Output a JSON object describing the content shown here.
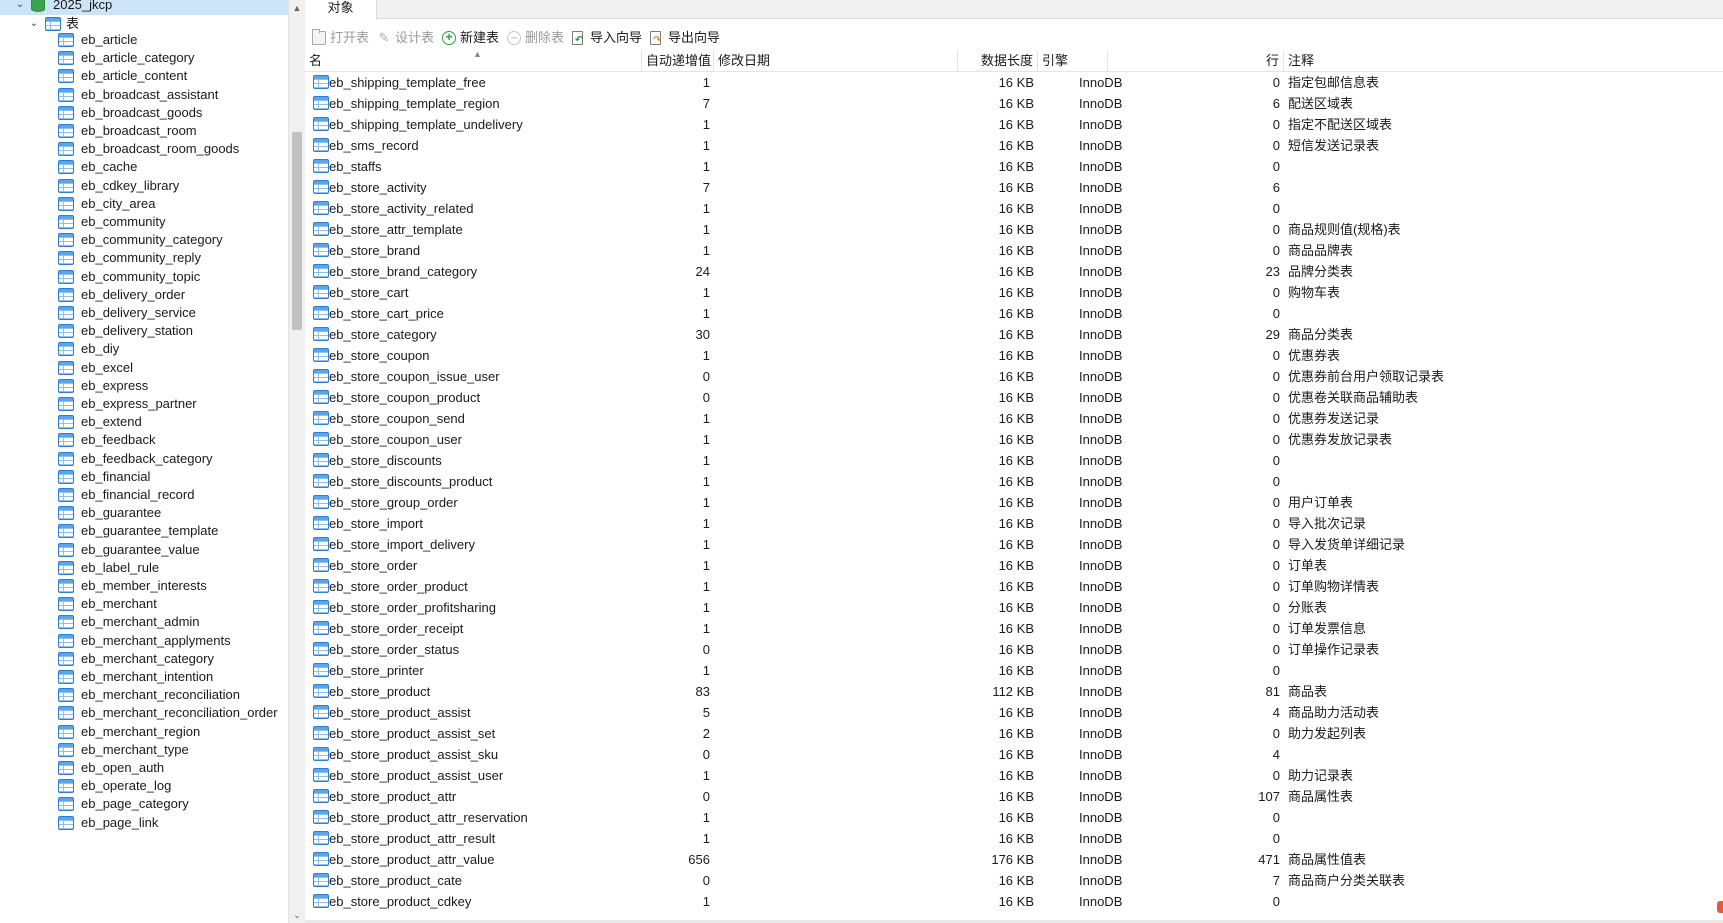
{
  "navigator": {
    "database": "2025_jkcp",
    "tables_node": "表",
    "tables": [
      "eb_article",
      "eb_article_category",
      "eb_article_content",
      "eb_broadcast_assistant",
      "eb_broadcast_goods",
      "eb_broadcast_room",
      "eb_broadcast_room_goods",
      "eb_cache",
      "eb_cdkey_library",
      "eb_city_area",
      "eb_community",
      "eb_community_category",
      "eb_community_reply",
      "eb_community_topic",
      "eb_delivery_order",
      "eb_delivery_service",
      "eb_delivery_station",
      "eb_diy",
      "eb_excel",
      "eb_express",
      "eb_express_partner",
      "eb_extend",
      "eb_feedback",
      "eb_feedback_category",
      "eb_financial",
      "eb_financial_record",
      "eb_guarantee",
      "eb_guarantee_template",
      "eb_guarantee_value",
      "eb_label_rule",
      "eb_member_interests",
      "eb_merchant",
      "eb_merchant_admin",
      "eb_merchant_applyments",
      "eb_merchant_category",
      "eb_merchant_intention",
      "eb_merchant_reconciliation",
      "eb_merchant_reconciliation_order",
      "eb_merchant_region",
      "eb_merchant_type",
      "eb_open_auth",
      "eb_operate_log",
      "eb_page_category",
      "eb_page_link"
    ]
  },
  "tabs": {
    "objects": "对象"
  },
  "toolbar": {
    "open_table": "打开表",
    "design_table": "设计表",
    "new_table": "新建表",
    "delete_table": "删除表",
    "import_wizard": "导入向导",
    "export_wizard": "导出向导"
  },
  "columns": {
    "name": "名",
    "auto_increment": "自动递增值",
    "modified": "修改日期",
    "data_length": "数据长度",
    "engine": "引擎",
    "rows": "行",
    "comment": "注释"
  },
  "table_rows": [
    {
      "name": "eb_shipping_template_free",
      "auto_inc": "1",
      "modified": "",
      "size": "16 KB",
      "engine": "InnoDB",
      "rows": "0",
      "comment": "指定包邮信息表"
    },
    {
      "name": "eb_shipping_template_region",
      "auto_inc": "7",
      "modified": "",
      "size": "16 KB",
      "engine": "InnoDB",
      "rows": "6",
      "comment": "配送区域表"
    },
    {
      "name": "eb_shipping_template_undelivery",
      "auto_inc": "1",
      "modified": "",
      "size": "16 KB",
      "engine": "InnoDB",
      "rows": "0",
      "comment": "指定不配送区域表"
    },
    {
      "name": "eb_sms_record",
      "auto_inc": "1",
      "modified": "",
      "size": "16 KB",
      "engine": "InnoDB",
      "rows": "0",
      "comment": "短信发送记录表"
    },
    {
      "name": "eb_staffs",
      "auto_inc": "1",
      "modified": "",
      "size": "16 KB",
      "engine": "InnoDB",
      "rows": "0",
      "comment": ""
    },
    {
      "name": "eb_store_activity",
      "auto_inc": "7",
      "modified": "",
      "size": "16 KB",
      "engine": "InnoDB",
      "rows": "6",
      "comment": ""
    },
    {
      "name": "eb_store_activity_related",
      "auto_inc": "1",
      "modified": "",
      "size": "16 KB",
      "engine": "InnoDB",
      "rows": "0",
      "comment": ""
    },
    {
      "name": "eb_store_attr_template",
      "auto_inc": "1",
      "modified": "",
      "size": "16 KB",
      "engine": "InnoDB",
      "rows": "0",
      "comment": "商品规则值(规格)表"
    },
    {
      "name": "eb_store_brand",
      "auto_inc": "1",
      "modified": "",
      "size": "16 KB",
      "engine": "InnoDB",
      "rows": "0",
      "comment": "商品品牌表"
    },
    {
      "name": "eb_store_brand_category",
      "auto_inc": "24",
      "modified": "",
      "size": "16 KB",
      "engine": "InnoDB",
      "rows": "23",
      "comment": "品牌分类表"
    },
    {
      "name": "eb_store_cart",
      "auto_inc": "1",
      "modified": "",
      "size": "16 KB",
      "engine": "InnoDB",
      "rows": "0",
      "comment": "购物车表"
    },
    {
      "name": "eb_store_cart_price",
      "auto_inc": "1",
      "modified": "",
      "size": "16 KB",
      "engine": "InnoDB",
      "rows": "0",
      "comment": ""
    },
    {
      "name": "eb_store_category",
      "auto_inc": "30",
      "modified": "",
      "size": "16 KB",
      "engine": "InnoDB",
      "rows": "29",
      "comment": "商品分类表"
    },
    {
      "name": "eb_store_coupon",
      "auto_inc": "1",
      "modified": "",
      "size": "16 KB",
      "engine": "InnoDB",
      "rows": "0",
      "comment": "优惠券表"
    },
    {
      "name": "eb_store_coupon_issue_user",
      "auto_inc": "0",
      "modified": "",
      "size": "16 KB",
      "engine": "InnoDB",
      "rows": "0",
      "comment": "优惠券前台用户领取记录表"
    },
    {
      "name": "eb_store_coupon_product",
      "auto_inc": "0",
      "modified": "",
      "size": "16 KB",
      "engine": "InnoDB",
      "rows": "0",
      "comment": "优惠卷关联商品辅助表"
    },
    {
      "name": "eb_store_coupon_send",
      "auto_inc": "1",
      "modified": "",
      "size": "16 KB",
      "engine": "InnoDB",
      "rows": "0",
      "comment": "优惠券发送记录"
    },
    {
      "name": "eb_store_coupon_user",
      "auto_inc": "1",
      "modified": "",
      "size": "16 KB",
      "engine": "InnoDB",
      "rows": "0",
      "comment": "优惠券发放记录表"
    },
    {
      "name": "eb_store_discounts",
      "auto_inc": "1",
      "modified": "",
      "size": "16 KB",
      "engine": "InnoDB",
      "rows": "0",
      "comment": ""
    },
    {
      "name": "eb_store_discounts_product",
      "auto_inc": "1",
      "modified": "",
      "size": "16 KB",
      "engine": "InnoDB",
      "rows": "0",
      "comment": ""
    },
    {
      "name": "eb_store_group_order",
      "auto_inc": "1",
      "modified": "",
      "size": "16 KB",
      "engine": "InnoDB",
      "rows": "0",
      "comment": "用户订单表"
    },
    {
      "name": "eb_store_import",
      "auto_inc": "1",
      "modified": "",
      "size": "16 KB",
      "engine": "InnoDB",
      "rows": "0",
      "comment": "导入批次记录"
    },
    {
      "name": "eb_store_import_delivery",
      "auto_inc": "1",
      "modified": "",
      "size": "16 KB",
      "engine": "InnoDB",
      "rows": "0",
      "comment": "导入发货单详细记录"
    },
    {
      "name": "eb_store_order",
      "auto_inc": "1",
      "modified": "",
      "size": "16 KB",
      "engine": "InnoDB",
      "rows": "0",
      "comment": "订单表"
    },
    {
      "name": "eb_store_order_product",
      "auto_inc": "1",
      "modified": "",
      "size": "16 KB",
      "engine": "InnoDB",
      "rows": "0",
      "comment": "订单购物详情表"
    },
    {
      "name": "eb_store_order_profitsharing",
      "auto_inc": "1",
      "modified": "",
      "size": "16 KB",
      "engine": "InnoDB",
      "rows": "0",
      "comment": "分账表"
    },
    {
      "name": "eb_store_order_receipt",
      "auto_inc": "1",
      "modified": "",
      "size": "16 KB",
      "engine": "InnoDB",
      "rows": "0",
      "comment": "订单发票信息"
    },
    {
      "name": "eb_store_order_status",
      "auto_inc": "0",
      "modified": "",
      "size": "16 KB",
      "engine": "InnoDB",
      "rows": "0",
      "comment": "订单操作记录表"
    },
    {
      "name": "eb_store_printer",
      "auto_inc": "1",
      "modified": "",
      "size": "16 KB",
      "engine": "InnoDB",
      "rows": "0",
      "comment": ""
    },
    {
      "name": "eb_store_product",
      "auto_inc": "83",
      "modified": "",
      "size": "112 KB",
      "engine": "InnoDB",
      "rows": "81",
      "comment": "商品表"
    },
    {
      "name": "eb_store_product_assist",
      "auto_inc": "5",
      "modified": "",
      "size": "16 KB",
      "engine": "InnoDB",
      "rows": "4",
      "comment": "商品助力活动表"
    },
    {
      "name": "eb_store_product_assist_set",
      "auto_inc": "2",
      "modified": "",
      "size": "16 KB",
      "engine": "InnoDB",
      "rows": "0",
      "comment": "助力发起列表"
    },
    {
      "name": "eb_store_product_assist_sku",
      "auto_inc": "0",
      "modified": "",
      "size": "16 KB",
      "engine": "InnoDB",
      "rows": "4",
      "comment": ""
    },
    {
      "name": "eb_store_product_assist_user",
      "auto_inc": "1",
      "modified": "",
      "size": "16 KB",
      "engine": "InnoDB",
      "rows": "0",
      "comment": "助力记录表"
    },
    {
      "name": "eb_store_product_attr",
      "auto_inc": "0",
      "modified": "",
      "size": "16 KB",
      "engine": "InnoDB",
      "rows": "107",
      "comment": "商品属性表"
    },
    {
      "name": "eb_store_product_attr_reservation",
      "auto_inc": "1",
      "modified": "",
      "size": "16 KB",
      "engine": "InnoDB",
      "rows": "0",
      "comment": ""
    },
    {
      "name": "eb_store_product_attr_result",
      "auto_inc": "1",
      "modified": "",
      "size": "16 KB",
      "engine": "InnoDB",
      "rows": "0",
      "comment": ""
    },
    {
      "name": "eb_store_product_attr_value",
      "auto_inc": "656",
      "modified": "",
      "size": "176 KB",
      "engine": "InnoDB",
      "rows": "471",
      "comment": "商品属性值表"
    },
    {
      "name": "eb_store_product_cate",
      "auto_inc": "0",
      "modified": "",
      "size": "16 KB",
      "engine": "InnoDB",
      "rows": "7",
      "comment": "商品商户分类关联表"
    },
    {
      "name": "eb_store_product_cdkey",
      "auto_inc": "1",
      "modified": "",
      "size": "16 KB",
      "engine": "InnoDB",
      "rows": "0",
      "comment": ""
    }
  ],
  "icons": {
    "database": "database-icon",
    "table": "table-icon",
    "expand": "chevron-down-icon"
  },
  "colors": {
    "selection": "#cce4f7",
    "table_icon": "#2d7fd6",
    "database_icon": "#3aa54c"
  }
}
